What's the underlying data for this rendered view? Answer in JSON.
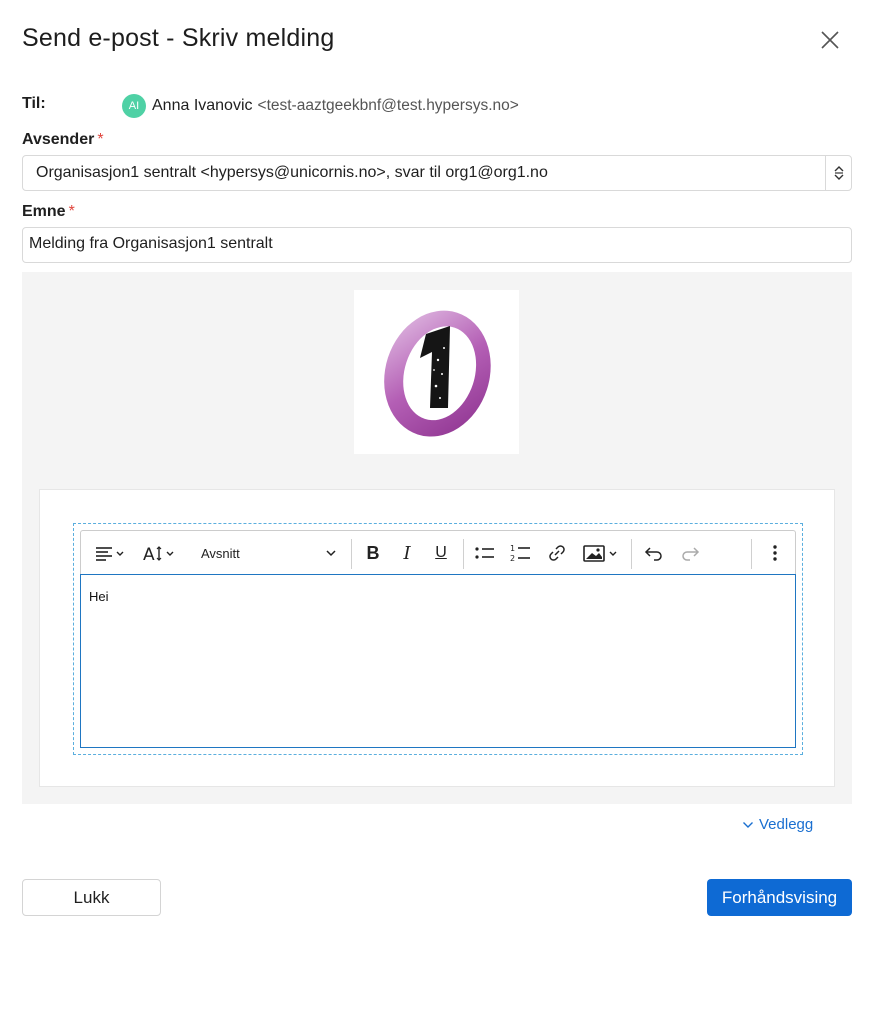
{
  "dialog": {
    "title": "Send e-post - Skriv melding"
  },
  "recipient": {
    "label": "Til:",
    "avatar_initials": "AI",
    "avatar_color": "#4fd1a5",
    "name": "Anna Ivanovic",
    "email": "<test-aaztgeekbnf@test.hypersys.no>"
  },
  "sender": {
    "label": "Avsender",
    "required_mark": "*",
    "value": "Organisasjon1 sentralt <hypersys@unicornis.no>, svar til org1@org1.no"
  },
  "subject": {
    "label": "Emne",
    "required_mark": "*",
    "value": "Melding fra Organisasjon1 sentralt"
  },
  "editor": {
    "block_format": "Avsnitt",
    "body_text": "Hei",
    "toolbar_icons": [
      "align-left-icon",
      "font-size-icon",
      "bold-icon",
      "italic-icon",
      "underline-icon",
      "bullet-list-icon",
      "numbered-list-icon",
      "link-icon",
      "image-icon",
      "undo-icon",
      "redo-icon",
      "more-options-icon"
    ]
  },
  "attachments": {
    "label": "Vedlegg"
  },
  "footer": {
    "close_label": "Lukk",
    "preview_label": "Forhåndsvising"
  },
  "colors": {
    "accent": "#0e6ad4",
    "link": "#1a6fd0",
    "required": "#e0443c",
    "logo": "#a64ca6"
  }
}
